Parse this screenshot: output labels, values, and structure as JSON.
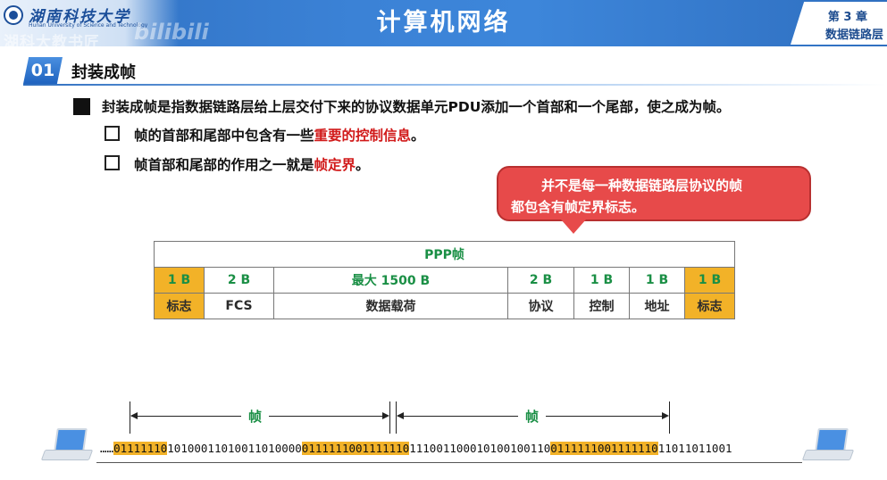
{
  "header": {
    "university_name": "湖南科技大学",
    "university_sub": "Hunan University of Science and Technology",
    "watermark": "湖科大教书匠",
    "platform_watermark": "bilibili",
    "course_title": "计算机网络",
    "chapter_number": "第 3 章",
    "chapter_name": "数据链路层"
  },
  "section": {
    "number": "01",
    "title": "封装成帧"
  },
  "bullets": {
    "main": "封装成帧是指数据链路层给上层交付下来的协议数据单元PDU添加一个首部和一个尾部，使之成为帧。",
    "sub1_prefix": "帧的首部和尾部中包含有一些",
    "sub1_highlight": "重要的控制信息",
    "sub1_suffix": "。",
    "sub2_prefix": "帧首部和尾部的作用之一就是",
    "sub2_highlight": "帧定界",
    "sub2_suffix": "。"
  },
  "callout": {
    "line1": "并不是每一种数据链路层协议的帧",
    "line2": "都包含有帧定界标志。"
  },
  "ppp_frame": {
    "title": "PPP帧",
    "sizes": [
      "1 B",
      "2 B",
      "最大 1500 B",
      "2 B",
      "1 B",
      "1 B",
      "1 B"
    ],
    "fields": [
      "标志",
      "FCS",
      "数据载荷",
      "协议",
      "控制",
      "地址",
      "标志"
    ]
  },
  "bitstream": {
    "frame_label_1": "帧",
    "frame_label_2": "帧",
    "prefix": "……",
    "seg1": "01111110",
    "seg2": "10100011010011010000",
    "seg3": "01111110",
    "seg4": "01111110",
    "seg5": "111001100010100100110",
    "seg6": "01111110",
    "seg7": "01111110",
    "seg8": "11011011001"
  },
  "colors": {
    "header_blue": "#3b82d6",
    "highlight_red": "#d11a1a",
    "callout_red": "#e74a4a",
    "flag_gold": "#f2b228",
    "field_green": "#1a8f45"
  },
  "icons": [
    "university-seal-icon",
    "laptop-icon"
  ]
}
